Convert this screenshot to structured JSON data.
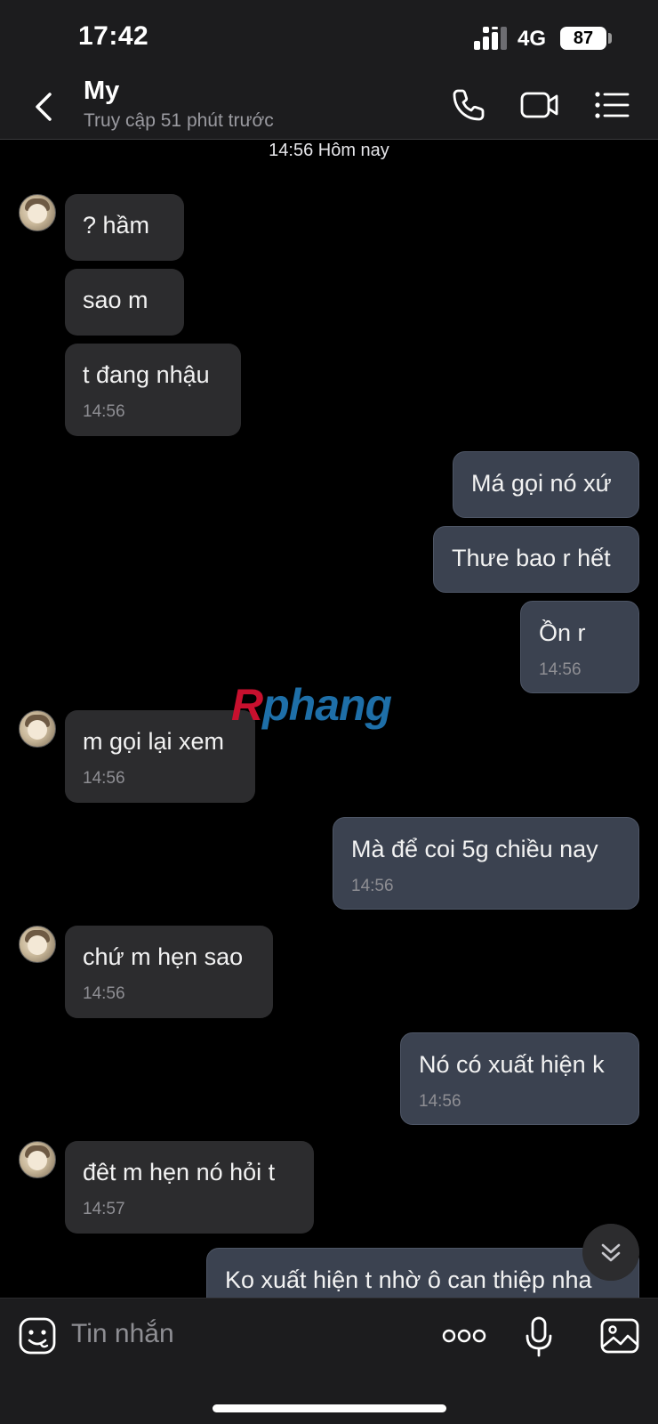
{
  "status_bar": {
    "time": "17:42",
    "network": "4G",
    "battery": "87"
  },
  "header": {
    "name": "My",
    "status": "Truy cập 51 phút trước"
  },
  "chat": {
    "date_separator": "14:56 Hôm nay",
    "messages": [
      {
        "dir": "in",
        "text": "? hầm"
      },
      {
        "dir": "in",
        "text": "sao m"
      },
      {
        "dir": "in",
        "text": "t đang nhậu",
        "time": "14:56"
      },
      {
        "dir": "out",
        "text": "Má gọi nó xứ"
      },
      {
        "dir": "out",
        "text": "Thưe bao r hết"
      },
      {
        "dir": "out",
        "text": "Ồn r",
        "time": "14:56"
      },
      {
        "dir": "in",
        "text": "m gọi lại xem",
        "time": "14:56"
      },
      {
        "dir": "out",
        "text": "Mà để coi 5g chiều nay",
        "time": "14:56"
      },
      {
        "dir": "in",
        "text": "chứ m hẹn sao",
        "time": "14:56"
      },
      {
        "dir": "out",
        "text": "Nó có xuất hiện k",
        "time": "14:56"
      },
      {
        "dir": "in",
        "text": "đêt m hẹn nó hỏi t",
        "time": "14:57"
      },
      {
        "dir": "out",
        "text": "Ko xuất hiện t nhờ ô can thiệp nha"
      }
    ]
  },
  "watermark": {
    "first": "R",
    "rest": "phang"
  },
  "composer": {
    "placeholder": "Tin nhắn"
  },
  "icons": {
    "back": "chevron-left-icon",
    "call": "phone-icon",
    "video": "video-camera-icon",
    "menu": "list-menu-icon",
    "emoji": "sticker-icon",
    "more": "more-dots-icon",
    "mic": "microphone-icon",
    "image": "image-icon",
    "scroll": "double-chevron-down-icon"
  }
}
